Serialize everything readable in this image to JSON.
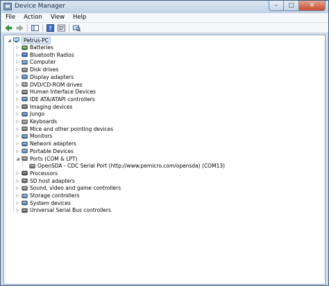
{
  "window": {
    "title": "Device Manager"
  },
  "menu": [
    "File",
    "Action",
    "View",
    "Help"
  ],
  "tree": {
    "root": "Petrus-PC",
    "items": [
      {
        "label": "Batteries",
        "icon": "battery-icon",
        "color": "#3f7e2c"
      },
      {
        "label": "Bluetooth Radios",
        "icon": "bluetooth-icon",
        "color": "#2a57b5"
      },
      {
        "label": "Computer",
        "icon": "computer-icon",
        "color": "#4d78a8"
      },
      {
        "label": "Disk drives",
        "icon": "disk-drive-icon",
        "color": "#6c6c6c"
      },
      {
        "label": "Display adapters",
        "icon": "display-adapter-icon",
        "color": "#3b72b0"
      },
      {
        "label": "DVD/CD-ROM drives",
        "icon": "dvd-drive-icon",
        "color": "#7a7a7a"
      },
      {
        "label": "Human Interface Devices",
        "icon": "hid-icon",
        "color": "#5f5f5f"
      },
      {
        "label": "IDE ATA/ATAPI controllers",
        "icon": "ide-controller-icon",
        "color": "#4e6f94"
      },
      {
        "label": "Imaging devices",
        "icon": "camera-icon",
        "color": "#555555"
      },
      {
        "label": "Jungo",
        "icon": "jungo-icon",
        "color": "#3c6aa0"
      },
      {
        "label": "Keyboards",
        "icon": "keyboard-icon",
        "color": "#777777"
      },
      {
        "label": "Mice and other pointing devices",
        "icon": "mouse-icon",
        "color": "#666666"
      },
      {
        "label": "Monitors",
        "icon": "monitor-icon",
        "color": "#3d6e9e"
      },
      {
        "label": "Network adapters",
        "icon": "network-adapter-icon",
        "color": "#3a74a8"
      },
      {
        "label": "Portable Devices",
        "icon": "portable-device-icon",
        "color": "#4f79a8"
      },
      {
        "label": "Ports (COM & LPT)",
        "icon": "port-icon",
        "color": "#6d6d6d",
        "expanded": true,
        "children": [
          {
            "label": "OpenSDA - CDC Serial Port (http://www.pemicro.com/opensda) (COM13)",
            "icon": "port-icon",
            "color": "#6d6d6d"
          }
        ]
      },
      {
        "label": "Processors",
        "icon": "processor-icon",
        "color": "#444444"
      },
      {
        "label": "SD host adapters",
        "icon": "sd-adapter-icon",
        "color": "#5a5a5a"
      },
      {
        "label": "Sound, video and game controllers",
        "icon": "sound-icon",
        "color": "#6a6a6a"
      },
      {
        "label": "Storage controllers",
        "icon": "storage-controller-icon",
        "color": "#5b7a9d"
      },
      {
        "label": "System devices",
        "icon": "system-device-icon",
        "color": "#4a6b90"
      },
      {
        "label": "Universal Serial Bus controllers",
        "icon": "usb-icon",
        "color": "#555555"
      }
    ]
  }
}
